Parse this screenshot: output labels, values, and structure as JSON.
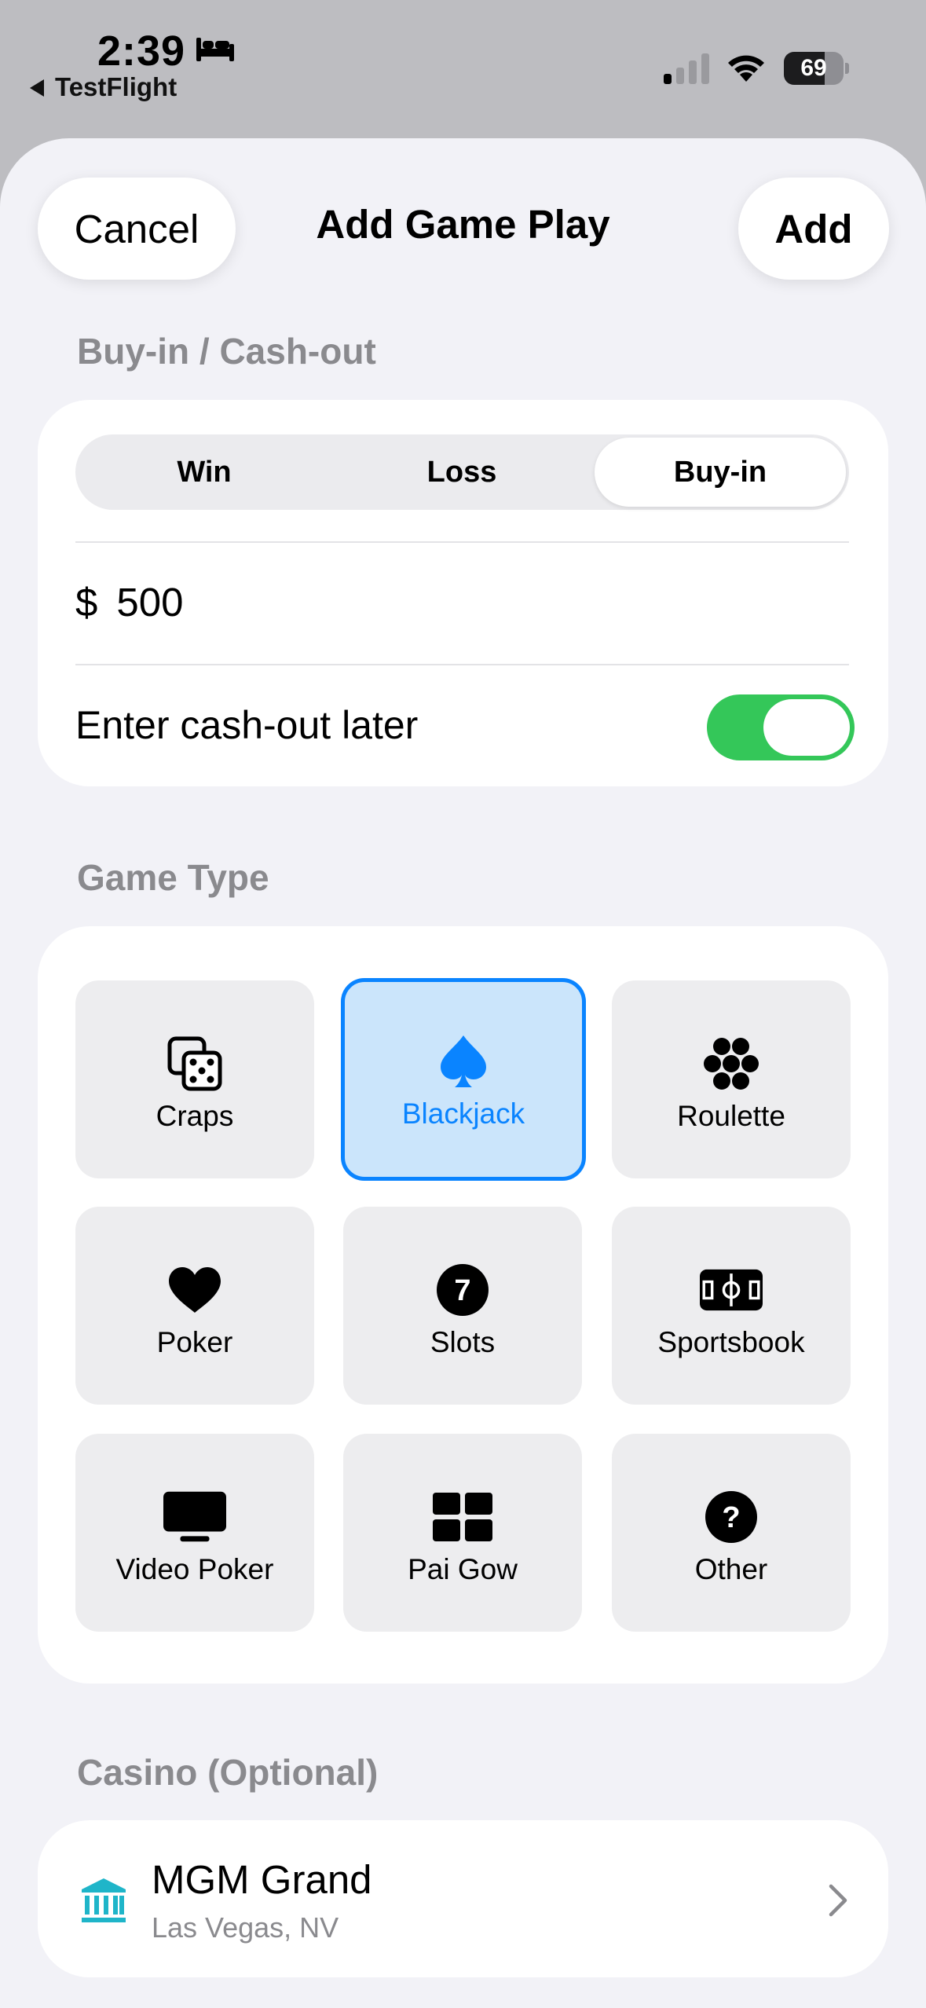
{
  "status_bar": {
    "time": "2:39",
    "back_app": "TestFlight",
    "battery_level": "69",
    "battery_fraction": 0.69
  },
  "nav": {
    "cancel_label": "Cancel",
    "title": "Add Game Play",
    "add_label": "Add"
  },
  "buyin_section": {
    "header": "Buy-in / Cash-out",
    "segments": [
      "Win",
      "Loss",
      "Buy-in"
    ],
    "selected_segment": "Buy-in",
    "currency_symbol": "$",
    "amount": "500",
    "toggle_label": "Enter cash-out later",
    "toggle_on": true
  },
  "game_type_section": {
    "header": "Game Type",
    "selected": "Blackjack",
    "types": [
      {
        "label": "Craps",
        "icon": "dice-icon"
      },
      {
        "label": "Blackjack",
        "icon": "spade-icon"
      },
      {
        "label": "Roulette",
        "icon": "roulette-icon"
      },
      {
        "label": "Poker",
        "icon": "heart-icon"
      },
      {
        "label": "Slots",
        "icon": "seven-icon"
      },
      {
        "label": "Sportsbook",
        "icon": "soccer-field-icon"
      },
      {
        "label": "Video Poker",
        "icon": "tv-icon"
      },
      {
        "label": "Pai Gow",
        "icon": "grid-icon"
      },
      {
        "label": "Other",
        "icon": "question-icon"
      }
    ]
  },
  "casino_section": {
    "header": "Casino (Optional)",
    "name": "MGM Grand",
    "location": "Las Vegas, NV",
    "icon": "building-columns-icon"
  },
  "colors": {
    "accent": "#0a84ff",
    "toggle_on": "#34c759",
    "casino_icon": "#1fb5c9",
    "secondary_text": "#8a8a8e",
    "background": "#f2f2f7"
  }
}
